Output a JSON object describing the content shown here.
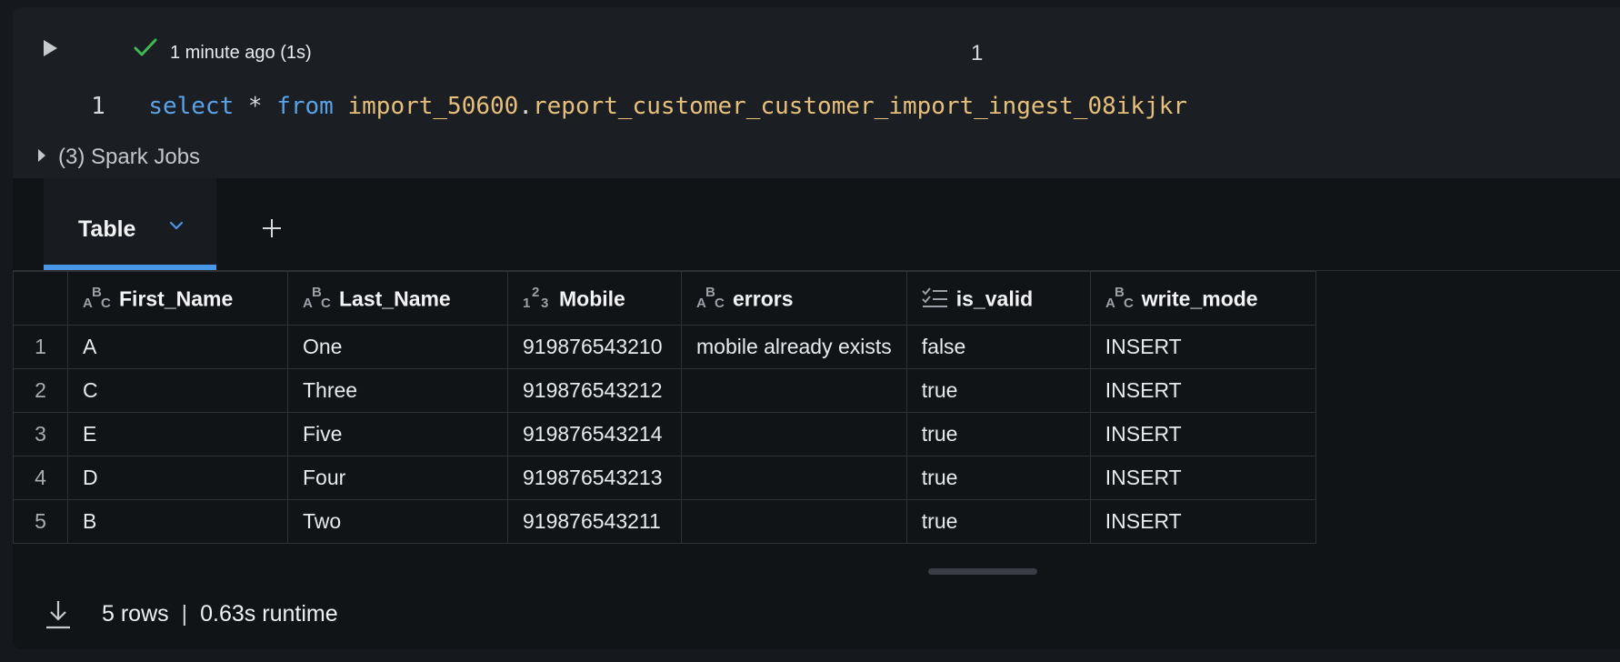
{
  "header": {
    "status_text": "1 minute ago (1s)",
    "cell_counter": "1"
  },
  "code": {
    "line_number": "1",
    "keyword_select": "select",
    "operator_star": "*",
    "keyword_from": "from",
    "schema": "import_50600",
    "dot": ".",
    "table": "report_customer_customer_import_ingest_08ikjkr"
  },
  "spark_jobs": {
    "label": "(3) Spark Jobs"
  },
  "tabs": {
    "table_label": "Table"
  },
  "grid": {
    "columns": [
      {
        "label": "First_Name",
        "type_icon": "abc-type-icon"
      },
      {
        "label": "Last_Name",
        "type_icon": "abc-type-icon"
      },
      {
        "label": "Mobile",
        "type_icon": "numeric-type-icon"
      },
      {
        "label": "errors",
        "type_icon": "abc-type-icon"
      },
      {
        "label": "is_valid",
        "type_icon": "boolean-type-icon"
      },
      {
        "label": "write_mode",
        "type_icon": "abc-type-icon"
      }
    ],
    "rows": [
      {
        "num": "1",
        "cells": [
          "A",
          "One",
          "919876543210",
          "mobile already exists",
          "false",
          "INSERT"
        ]
      },
      {
        "num": "2",
        "cells": [
          "C",
          "Three",
          "919876543212",
          "",
          "true",
          "INSERT"
        ]
      },
      {
        "num": "3",
        "cells": [
          "E",
          "Five",
          "919876543214",
          "",
          "true",
          "INSERT"
        ]
      },
      {
        "num": "4",
        "cells": [
          "D",
          "Four",
          "919876543213",
          "",
          "true",
          "INSERT"
        ]
      },
      {
        "num": "5",
        "cells": [
          "B",
          "Two",
          "919876543211",
          "",
          "true",
          "INSERT"
        ]
      }
    ]
  },
  "footer": {
    "rows_text": "5 rows",
    "separator": "|",
    "runtime_text": "0.63s runtime"
  },
  "colors": {
    "accent": "#4a97e8",
    "success": "#3fb950",
    "keyword": "#5aa2e6",
    "identifier": "#e6c07b"
  }
}
